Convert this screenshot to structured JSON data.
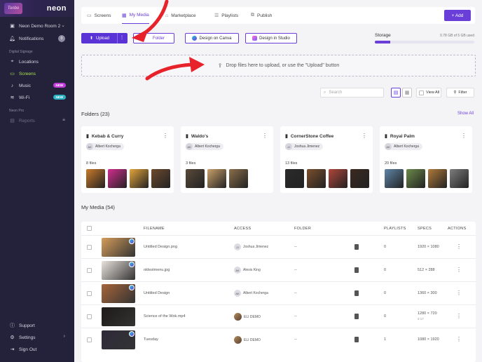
{
  "sidebar": {
    "logo_badge": "Tonbo",
    "brand": "neon",
    "org": "Neon Demo Room 2",
    "notifications_label": "Notifications",
    "notifications_count": "0",
    "section_signage": "Digital Signage",
    "items": [
      {
        "label": "Locations",
        "icon": "location-pin-icon"
      },
      {
        "label": "Screens",
        "icon": "monitor-icon"
      },
      {
        "label": "Music",
        "icon": "music-icon",
        "badge": "NEW",
        "badge_color": "#c13cd9"
      },
      {
        "label": "Wi-Fi",
        "icon": "wifi-icon",
        "badge": "NEW",
        "badge_color": "#2bb3c4"
      }
    ],
    "section_pro": "Neon Pro",
    "reports_label": "Reports",
    "support_label": "Support",
    "settings_label": "Settings",
    "signout_label": "Sign Out"
  },
  "topbar": {
    "tabs": [
      {
        "label": "Screens"
      },
      {
        "label": "My Media"
      },
      {
        "label": "Marketplace"
      },
      {
        "label": "Playlists"
      },
      {
        "label": "Publish"
      }
    ],
    "add_label": "+ Add"
  },
  "actions": {
    "upload_label": "Upload",
    "folder_label": "Folder",
    "canva_label": "Design on Canva",
    "studio_label": "Design in Studio"
  },
  "storage": {
    "label": "Storage",
    "value": "0.78 GB of 5 GB used",
    "fraction": 0.156
  },
  "dropzone": {
    "text": "Drop files here to upload, or use the \"Upload\" button"
  },
  "toolbar": {
    "search_placeholder": "Search",
    "view_all_label": "View All",
    "filter_label": "Filter"
  },
  "folders": {
    "title": "Folders (23)",
    "show_all": "Show All",
    "items": [
      {
        "name": "Kebab & Curry",
        "owner_initials": "AK",
        "owner": "Albert Kocherga",
        "files": "8 files",
        "thumbs": [
          "#c97a2a",
          "#d22d8f",
          "#e3a53b",
          "#6d4a2e"
        ]
      },
      {
        "name": "Waldo's",
        "owner_initials": "AK",
        "owner": "Albert Kocherga",
        "files": "3 files",
        "thumbs": [
          "#5a4a3a",
          "#c9a06a",
          "#8a6e4a"
        ]
      },
      {
        "name": "CornerStone Coffee",
        "owner_initials": "JJ",
        "owner": "Joshua Jimenez",
        "files": "13 files",
        "thumbs": [
          "#2b2b2b",
          "#7a4e2c",
          "#b0463a",
          "#3b2a20"
        ]
      },
      {
        "name": "Royal Palm",
        "owner_initials": "AK",
        "owner": "Albert Kocherga",
        "files": "20 files",
        "thumbs": [
          "#5f86a8",
          "#6c8a4a",
          "#b07a3a",
          "#7d7d7d"
        ]
      }
    ]
  },
  "media": {
    "title": "My Media (54)",
    "columns": {
      "filename": "FILENAME",
      "access": "ACCESS",
      "folder": "FOLDER",
      "playlists": "PLAYLISTS",
      "specs": "SPECS",
      "actions": "ACTIONS"
    },
    "rows": [
      {
        "filename": "Untitled Design.png",
        "access_initials": "JJ",
        "access": "Joshua Jimenez",
        "folder": "--",
        "playlists": "0",
        "specs": "1920 × 1080",
        "specs2": "",
        "thumb": "#d59c5a",
        "has_canva": true
      },
      {
        "filename": "oldestmenu.jpg",
        "access_initials": "AK",
        "access": "Alexis King",
        "folder": "--",
        "playlists": "0",
        "specs": "512 × 288",
        "specs2": "",
        "thumb": "#e9e2dc",
        "has_canva": true
      },
      {
        "filename": "Untitled Design",
        "access_initials": "AK",
        "access": "Albert Kocherga",
        "folder": "--",
        "playlists": "0",
        "specs": "1360 × 300",
        "specs2": "",
        "thumb": "#a7653a",
        "has_canva": true
      },
      {
        "filename": "Science of the Wok.mp4",
        "access_initials": "",
        "access": "ELI DEMO",
        "folder": "--",
        "playlists": "0",
        "specs": "1280 × 720",
        "specs2": "2:17",
        "thumb": "#1d1a17",
        "has_canva": false
      },
      {
        "filename": "Tuesday",
        "access_initials": "",
        "access": "ELI DEMO",
        "folder": "--",
        "playlists": "1",
        "specs": "1080 × 1920",
        "specs2": "",
        "thumb": "#2e2a3a",
        "has_canva": true
      }
    ]
  }
}
